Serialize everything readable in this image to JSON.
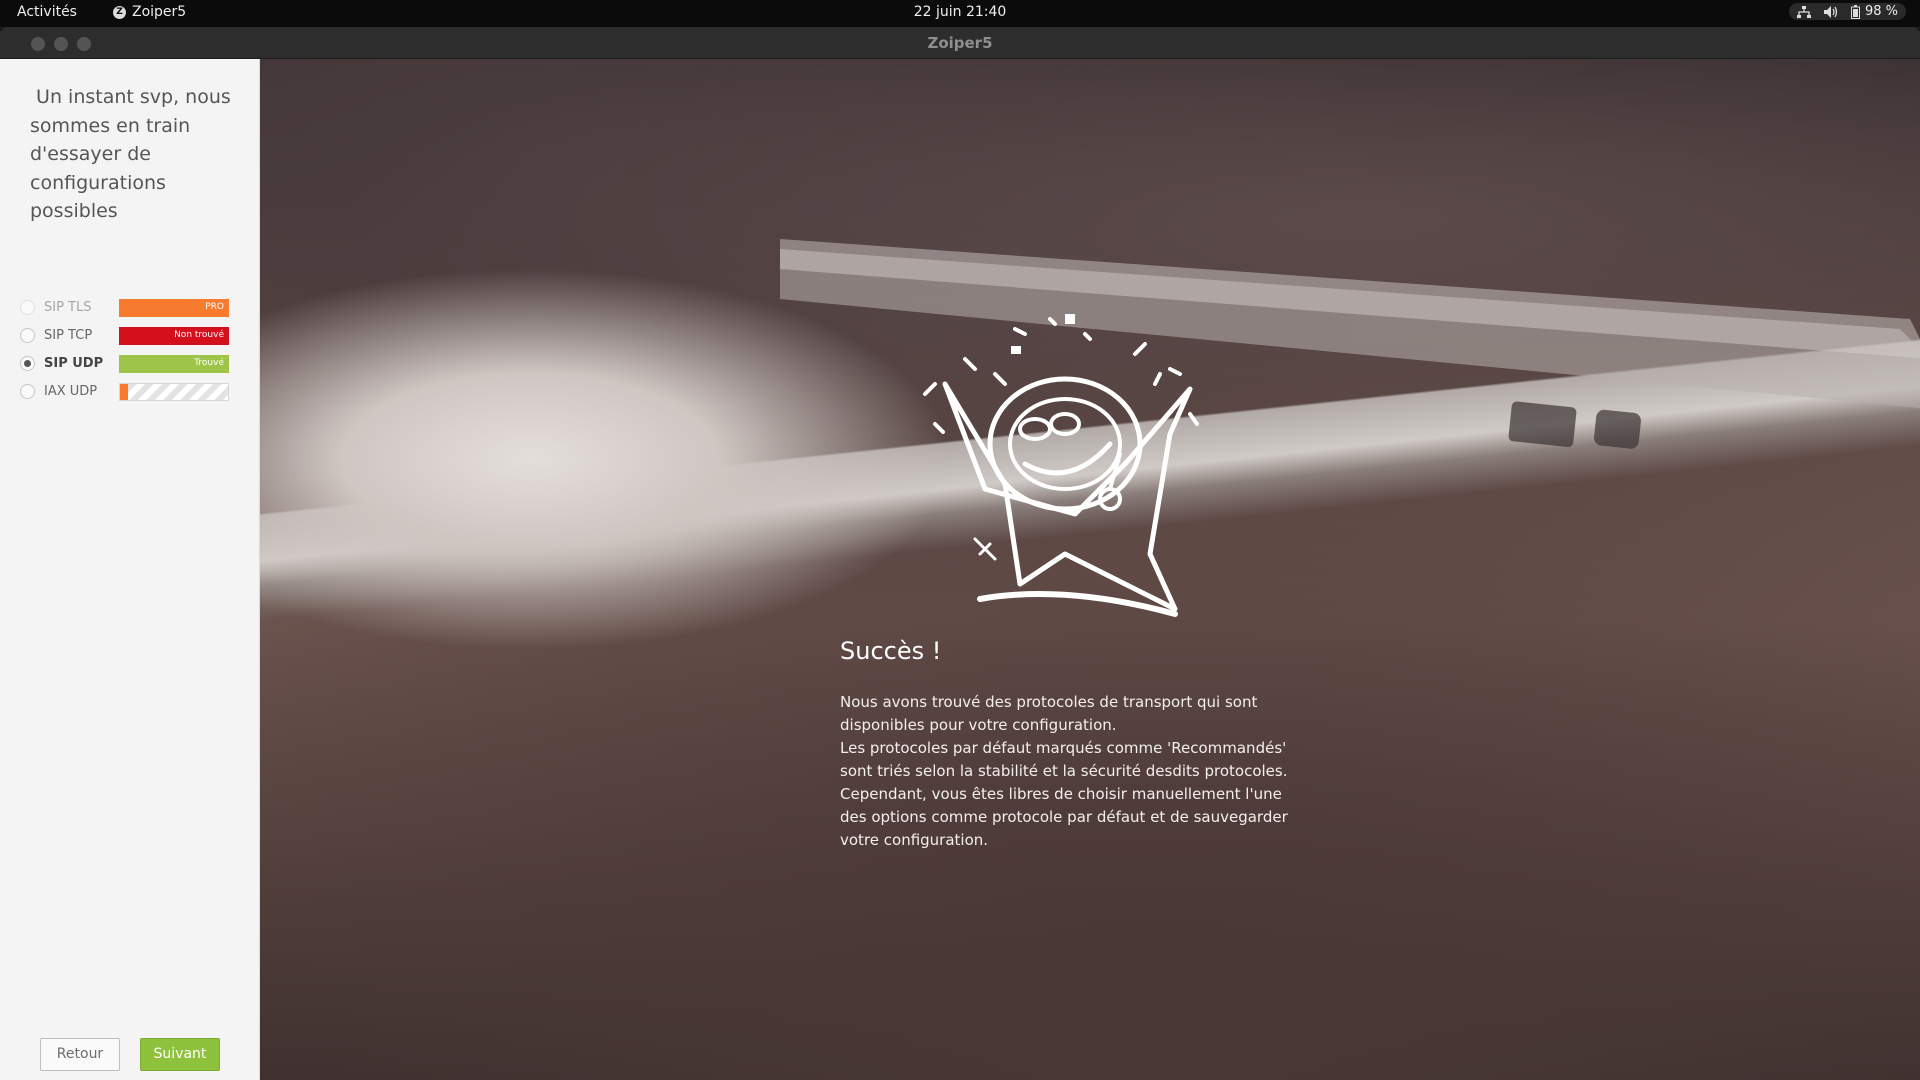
{
  "topbar": {
    "activities": "Activités",
    "app_name": "Zoiper5",
    "clock": "22 juin  21:40",
    "battery": "98 %"
  },
  "window": {
    "title": "Zoiper5"
  },
  "sidebar": {
    "heading": " Un instant svp, nous sommes en train d'essayer de configurations possibles",
    "protocols": [
      {
        "label": "SIP TLS",
        "status": "PRO",
        "color": "#f77b2e",
        "selected": false,
        "enabled": false
      },
      {
        "label": "SIP TCP",
        "status": "Non trouvé",
        "color": "#d4101d",
        "selected": false,
        "enabled": true
      },
      {
        "label": "SIP UDP",
        "status": "Trouvé",
        "color": "#9fc44a",
        "selected": true,
        "enabled": true
      },
      {
        "label": "IAX UDP",
        "status": "",
        "progress_percent": 7,
        "selected": false,
        "enabled": true
      }
    ],
    "back_label": "Retour",
    "next_label": "Suivant"
  },
  "main": {
    "title": "Succès !",
    "body": [
      " Nous avons trouvé des protocoles de transport qui sont disponibles pour votre configuration.",
      "Les protocoles par défaut marqués comme 'Recommandés' sont triés selon la stabilité et la sécurité desdits protocoles. Cependant, vous êtes libres de choisir manuellement l'une des options comme protocole par défaut et de sauvegarder votre configuration."
    ]
  }
}
